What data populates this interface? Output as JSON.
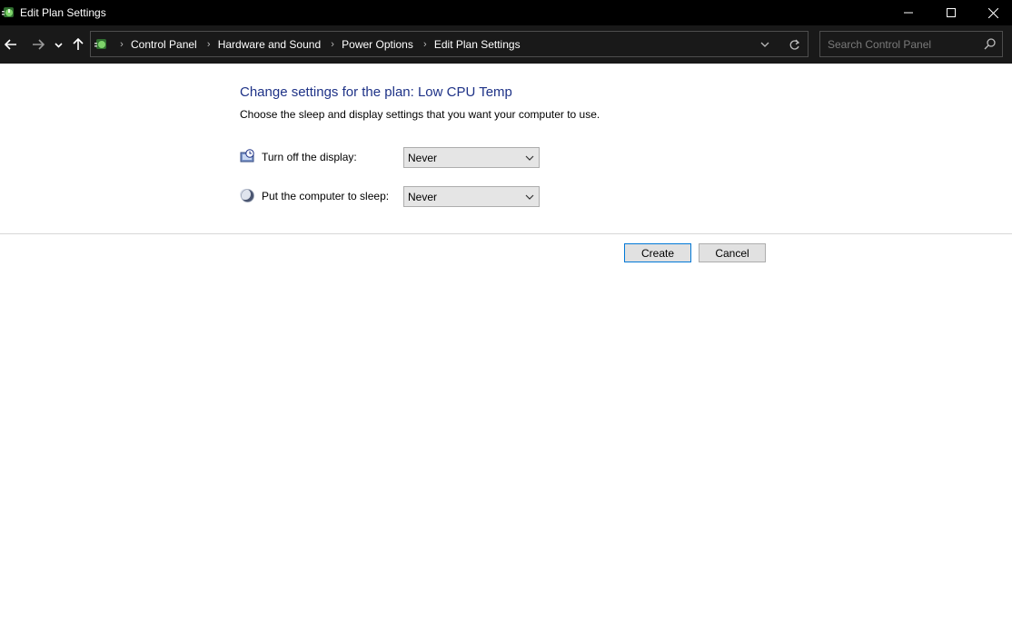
{
  "window": {
    "title": "Edit Plan Settings",
    "icons": {
      "app": "power-options-icon",
      "minimize": "minimize-icon",
      "maximize": "maximize-icon",
      "close": "close-icon"
    }
  },
  "navigation": {
    "back_icon": "arrow-left-icon",
    "forward_icon": "arrow-right-icon",
    "recent_icon": "chevron-down-icon",
    "up_icon": "arrow-up-icon",
    "breadcrumb": [
      {
        "label": "Control Panel"
      },
      {
        "label": "Hardware and Sound"
      },
      {
        "label": "Power Options"
      },
      {
        "label": "Edit Plan Settings"
      }
    ],
    "refresh_icon": "refresh-icon",
    "search": {
      "placeholder": "Search Control Panel",
      "value": ""
    }
  },
  "main": {
    "heading": "Change settings for the plan: Low CPU Temp",
    "subtext": "Choose the sleep and display settings that you want your computer to use.",
    "settings": [
      {
        "label": "Turn off the display:",
        "value": "Never",
        "icon": "monitor-clock-icon"
      },
      {
        "label": "Put the computer to sleep:",
        "value": "Never",
        "icon": "moon-icon"
      }
    ],
    "buttons": {
      "create": "Create",
      "cancel": "Cancel"
    }
  },
  "colors": {
    "titlebar": "#000000",
    "navbar": "#191919",
    "heading": "#1e3287",
    "accent": "#0078d7"
  }
}
